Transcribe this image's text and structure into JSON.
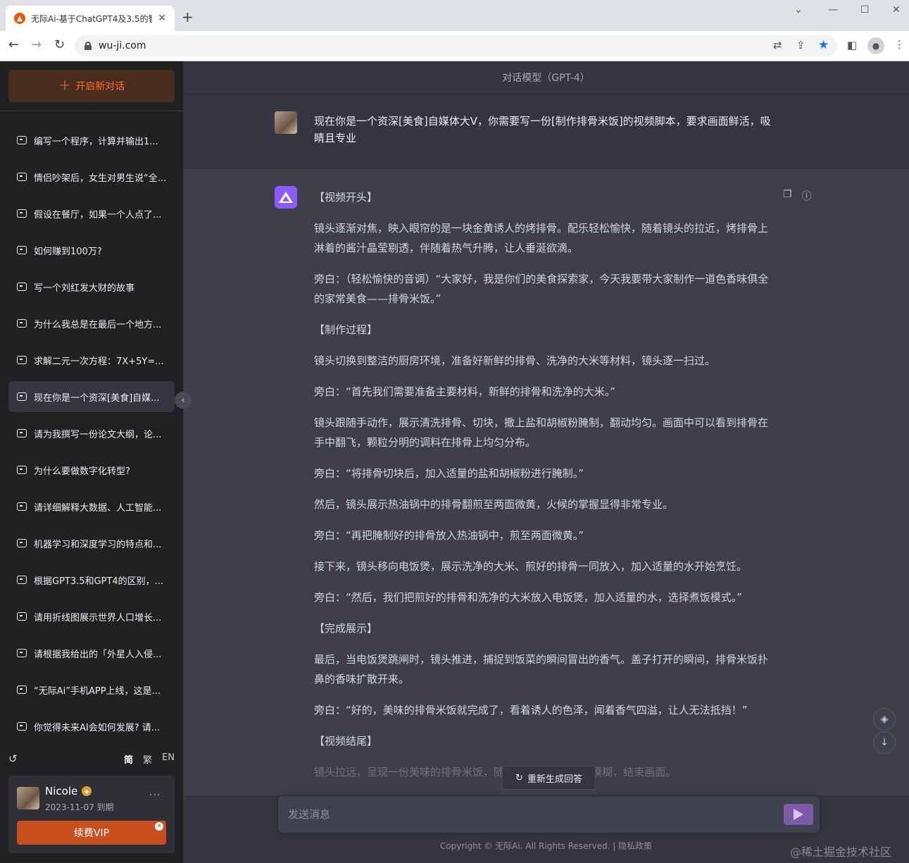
{
  "browser": {
    "tab_title": "无际Ai-基于ChatGPT4及3.5的智",
    "tab_close": "✕",
    "new_tab": "+",
    "url": "wu-ji.com"
  },
  "sidebar": {
    "new_chat_label": "开启新对话",
    "conversations": [
      "编写一个程序，计算并输出1...",
      "情侣吵架后，女生对男生说“全...",
      "假设在餐厅，如果一个人点了...",
      "如何赚到100万?",
      "写一个刘红发大财的故事",
      "为什么我总是在最后一个地方...",
      "求解二元一次方程：7X+5Y=...",
      "现在你是一个资深[美食]自媒...",
      "请为我撰写一份论文大纲，论...",
      "为什么要做数字化转型?",
      "请详细解释大数据、人工智能...",
      "机器学习和深度学习的特点和...",
      "根据GPT3.5和GPT4的区别，...",
      "请用折线图展示世界人口增长...",
      "请根据我给出的「外星人入侵...",
      "“无际Ai”手机APP上线，这是...",
      "你觉得未来AI会如何发展? 请..."
    ],
    "active_index": 7,
    "lang": {
      "simplified": "简",
      "traditional": "繁",
      "english": "EN"
    },
    "user": {
      "name": "Nicole",
      "expire": "2023-11-07 到期",
      "more": "···",
      "renew_label": "续费VIP"
    }
  },
  "main": {
    "model_label": "对话模型（GPT-4）",
    "user_message": "现在你是一个资深[美食]自媒体大V，你需要写一份[制作排骨米饭]的视频脚本，要求画面鲜活，吸睛且专业",
    "ai_paragraphs": [
      "【视频开头】",
      "镜头逐渐对焦，映入眼帘的是一块金黄诱人的烤排骨。配乐轻松愉快，随着镜头的拉近，烤排骨上淋着的酱汁晶莹剔透，伴随着热气升腾，让人垂涎欲滴。",
      "旁白：（轻松愉快的音调）“大家好，我是你们的美食探索家，今天我要带大家制作一道色香味俱全的家常美食——排骨米饭。”",
      "【制作过程】",
      "镜头切换到整洁的厨房环境，准备好新鲜的排骨、洗净的大米等材料，镜头逐一扫过。",
      "旁白：“首先我们需要准备主要材料，新鲜的排骨和洗净的大米。”",
      "镜头跟随手动作，展示清洗排骨、切块，撒上盐和胡椒粉腌制，翻动均匀。画面中可以看到排骨在手中翻飞，颗粒分明的调料在排骨上均匀分布。",
      "旁白：“将排骨切块后，加入适量的盐和胡椒粉进行腌制。”",
      "然后，镜头展示热油锅中的排骨翻煎至两面微黄，火候的掌握显得非常专业。",
      "旁白：“再把腌制好的排骨放入热油锅中，煎至两面微黄。”",
      "接下来，镜头移向电饭煲，展示洗净的大米、煎好的排骨一同放入，加入适量的水开始烹饪。",
      "旁白：“然后，我们把煎好的排骨和洗净的大米放入电饭煲，加入适量的水，选择煮饭模式。”",
      "【完成展示】",
      "最后，当电饭煲跳闸时，镜头推进，捕捉到饭菜的瞬间冒出的香气。盖子打开的瞬间，排骨米饭扑鼻的香味扩散开来。",
      "旁白：“好的，美味的排骨米饭就完成了，看着诱人的色泽，闻着香气四溢，让人无法抵挡！”",
      "【视频结尾】"
    ],
    "ai_paragraph_faded": "镜头拉远，呈现一份美味的排骨米饭，随后镜头... 随后逐渐模糊，结束画面。",
    "regen_label": "重新生成回答",
    "input_placeholder": "发送消息",
    "copyright": "Copyright © 无际Ai. All Rights Reserved. | 隐私政策"
  },
  "watermark": "@稀土掘金技术社区",
  "colors": {
    "accent": "#ff6a2c",
    "ai_avatar": "#8b5cf6",
    "renew": "#c8501f"
  }
}
